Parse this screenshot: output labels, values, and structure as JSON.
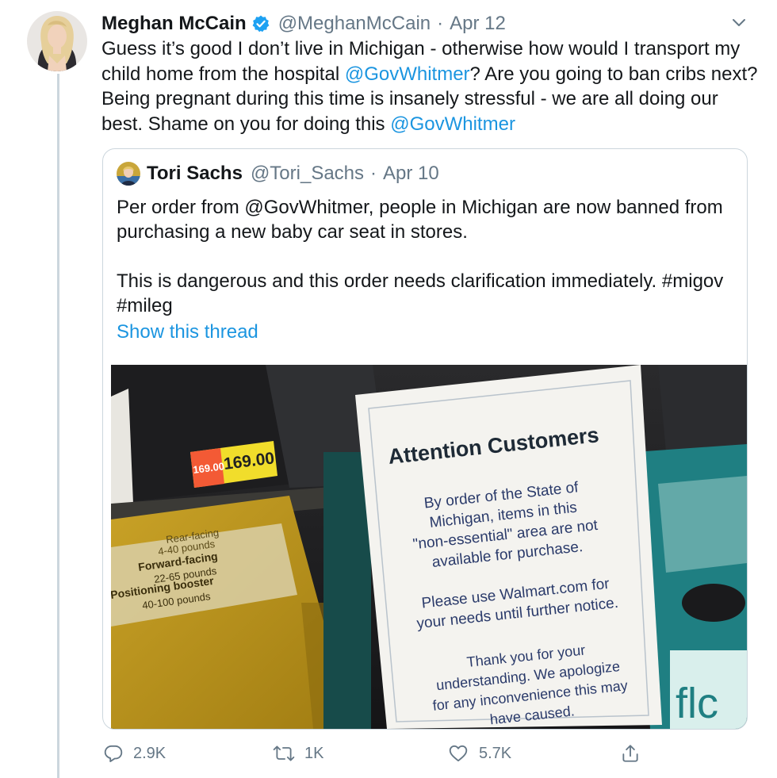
{
  "tweet": {
    "author_name": "Meghan McCain",
    "handle": "@MeghanMcCain",
    "separator": "·",
    "date": "Apr 12",
    "text_1": "Guess it’s good I don’t live in Michigan - otherwise how would I transport my child home from the hospital ",
    "mention_1": "@GovWhitmer",
    "text_2": "? Are you going to ban cribs next? Being pregnant during this time is insanely stressful - we are all doing our best. Shame on you for doing this ",
    "mention_2": "@GovWhitmer"
  },
  "quote": {
    "author_name": "Tori Sachs",
    "handle": "@Tori_Sachs",
    "separator": "·",
    "date": "Apr 10",
    "text": "Per order from @GovWhitmer, people in Michigan are now banned from purchasing a new baby car seat in stores.\n\nThis is dangerous and this order needs clarification immediately. #migov #mileg",
    "show_thread": "Show this thread"
  },
  "photo": {
    "price_tag_small": "169.00",
    "price_tag": "169.00",
    "box_lines": [
      "Rear-facing",
      "4-40 pounds",
      "Forward-facing",
      "22-65 pounds",
      "Positioning booster",
      "40-100 pounds"
    ],
    "sign_title": "Attention Customers",
    "sign_p1": [
      "By order of the State of",
      "Michigan, items in this",
      "\"non-essential\" area are not",
      "available for purchase."
    ],
    "sign_p2": [
      "Please use Walmart.com for",
      "your needs until further notice."
    ],
    "sign_p3": [
      "Thank you for your",
      "understanding. We apologize",
      "for any inconvenience this may",
      "have caused."
    ],
    "box_logo": "flc"
  },
  "actions": {
    "replies": "2.9K",
    "retweets": "1K",
    "likes": "5.7K"
  },
  "colors": {
    "link": "#1b95e0",
    "secondary_text": "#657786",
    "border": "#ccd6dd",
    "verified": "#1da1f2"
  },
  "icons": [
    "verified-badge-icon",
    "chevron-down-icon",
    "reply-icon",
    "retweet-icon",
    "like-icon",
    "share-icon"
  ]
}
